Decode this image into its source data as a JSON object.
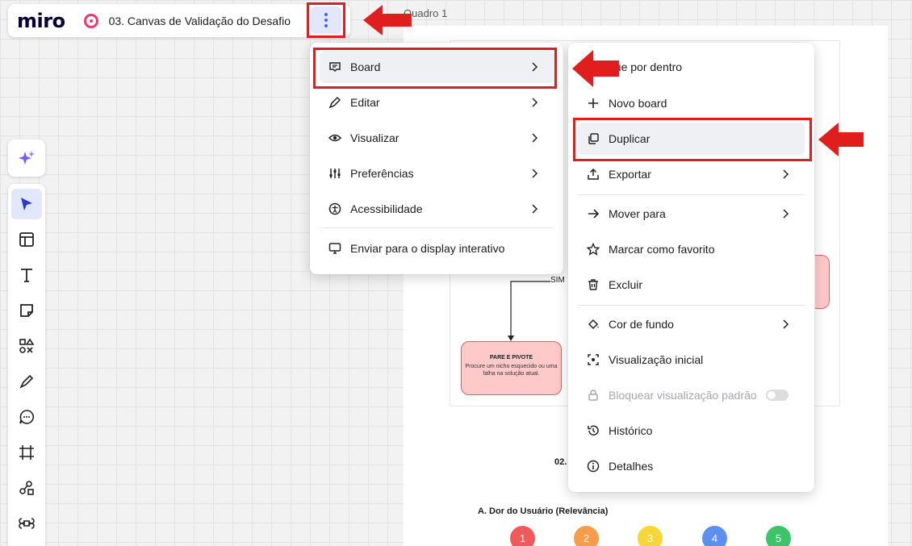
{
  "app": {
    "logo": "miro",
    "board_title": "03. Canvas de Validação do Desafio"
  },
  "canvas": {
    "frame_label": "Quadro 1",
    "flow_label_yes": "SIM",
    "flow_box_title": "PARE E PIVOTE",
    "flow_box_text": "Procure um nicho esquecido ou uma falha na solução atual.",
    "section_partial": "02.",
    "section_title": "A. Dor do Usuário (Relevância)",
    "ratings": [
      {
        "label": "1",
        "color": "#f05a5a"
      },
      {
        "label": "2",
        "color": "#f79c4a"
      },
      {
        "label": "3",
        "color": "#f7d63c"
      },
      {
        "label": "4",
        "color": "#5b8ff0"
      },
      {
        "label": "5",
        "color": "#3dc46a"
      }
    ]
  },
  "main_menu": {
    "items": [
      {
        "label": "Board",
        "icon": "board-icon",
        "submenu": true
      },
      {
        "label": "Editar",
        "icon": "pen-icon",
        "submenu": true
      },
      {
        "label": "Visualizar",
        "icon": "eye-icon",
        "submenu": true
      },
      {
        "label": "Preferências",
        "icon": "sliders-icon",
        "submenu": true
      },
      {
        "label": "Acessibilidade",
        "icon": "accessibility-icon",
        "submenu": true
      },
      {
        "label": "Enviar para o display interativo",
        "icon": "display-icon",
        "submenu": false
      }
    ]
  },
  "board_submenu": {
    "items": [
      {
        "label": "que por dentro",
        "icon": "none"
      },
      {
        "label": "Novo board",
        "icon": "plus-icon"
      },
      {
        "label": "Duplicar",
        "icon": "duplicate-icon"
      },
      {
        "label": "Exportar",
        "icon": "export-icon",
        "submenu": true
      },
      {
        "label": "Mover para",
        "icon": "arrow-right-icon",
        "submenu": true
      },
      {
        "label": "Marcar como favorito",
        "icon": "star-icon"
      },
      {
        "label": "Excluir",
        "icon": "trash-icon"
      },
      {
        "label": "Cor de fundo",
        "icon": "paint-bucket-icon",
        "submenu": true
      },
      {
        "label": "Visualização inicial",
        "icon": "initial-view-icon"
      },
      {
        "label": "Bloquear visualização padrão",
        "icon": "lock-icon",
        "disabled": true,
        "toggle": "off"
      },
      {
        "label": "Histórico",
        "icon": "history-icon"
      },
      {
        "label": "Detalhes",
        "icon": "info-icon"
      }
    ]
  },
  "colors": {
    "accent": "#4262ff",
    "highlight_box": "#e01e1e",
    "arrow": "#e01e1e"
  }
}
